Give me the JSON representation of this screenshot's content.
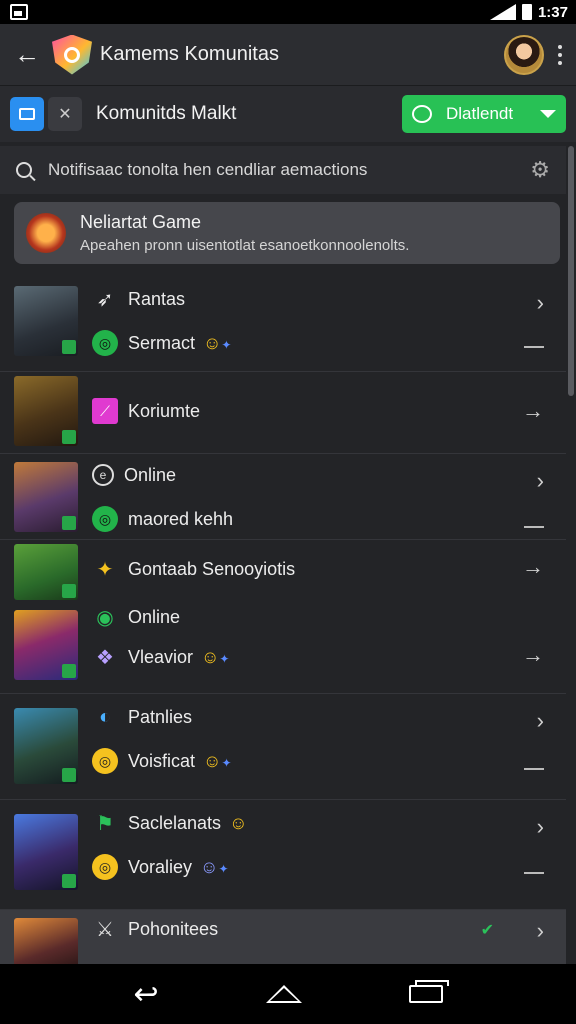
{
  "status": {
    "time": "1:37"
  },
  "appbar": {
    "title": "Kamems Komunitas"
  },
  "subbar": {
    "title": "Komunitds Malkt",
    "join_label": "Dlatlendt"
  },
  "search": {
    "placeholder": "Notifisaac tonolta hen cendliar aemactions"
  },
  "featured": {
    "title": "Neliartat Game",
    "subtitle": "Apeahen pronn uisentotlat esanoetkonnoolenolts."
  },
  "rows": [
    {
      "line1": {
        "icon": "sword-icon",
        "text": "Rantas"
      },
      "line2": {
        "icon": "green-circle-icon",
        "text": "Sermact",
        "emoji": "☺"
      }
    },
    {
      "line1": {
        "icon": "pink-square-icon",
        "text": "Koriumte"
      }
    },
    {
      "line1": {
        "icon": "outline-circle-icon",
        "text": "Online"
      },
      "line2": {
        "icon": "green-circle-icon",
        "text": "maored kehh"
      }
    },
    {
      "line1": {
        "icon": "star-icon",
        "text": "Gontaab Senooyiotis"
      }
    },
    {
      "line1": {
        "icon": "eye-icon",
        "text": "Online"
      },
      "line2": {
        "icon": "gem-icon",
        "text": "Vleavior",
        "emoji": "☺"
      }
    },
    {
      "line1": {
        "icon": "crescent-icon",
        "text": "Patnlies"
      },
      "line2": {
        "icon": "yellow-circle-icon",
        "text": "Voisficat",
        "emoji": "☺"
      }
    },
    {
      "line1": {
        "icon": "flag-icon",
        "text": "Saclelanats",
        "emoji": "☺"
      },
      "line2": {
        "icon": "yellow-circle-icon",
        "text": "Voraliey",
        "emoji": "☺"
      }
    },
    {
      "line1": {
        "icon": "crossed-swords-icon",
        "text": "Pohonitees"
      }
    }
  ],
  "colors": {
    "accent": "#28c155",
    "background": "#232427"
  }
}
